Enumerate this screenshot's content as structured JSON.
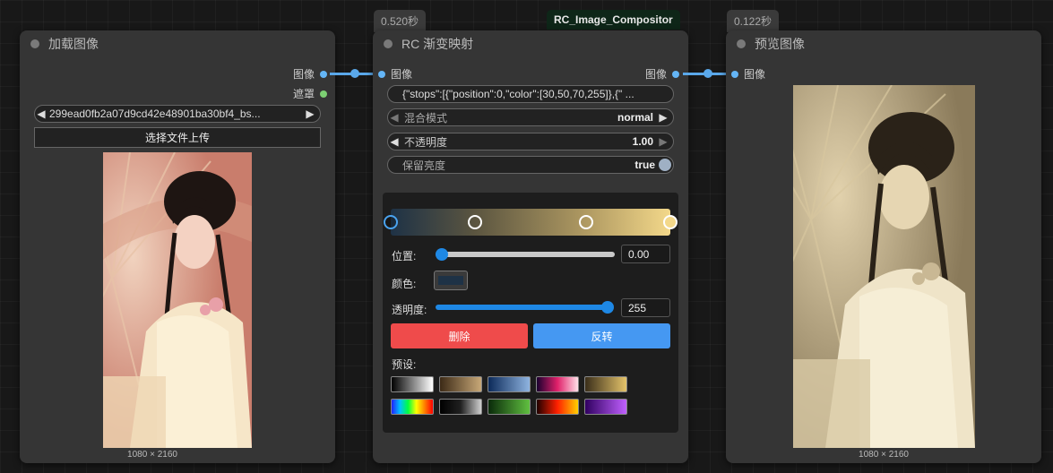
{
  "nodes": {
    "load_image": {
      "title": "加载图像",
      "outputs": [
        "图像",
        "遮罩"
      ],
      "file_name": "299ead0fb2a07d9cd42e48901ba30bf4_bs...",
      "upload_label": "选择文件上传",
      "image_size": "1080 × 2160"
    },
    "gradient_map": {
      "badge_time": "0.520秒",
      "title": "RC 渐变映射",
      "input_label": "图像",
      "output_label": "图像",
      "stops_text": "{\"stops\":[{\"position\":0,\"color\":[30,50,70,255]},{\"  ...",
      "blend_mode": {
        "label": "混合模式",
        "value": "normal"
      },
      "opacity": {
        "label": "不透明度",
        "value": "1.00"
      },
      "preserve_luminosity": {
        "label": "保留亮度",
        "value": "true"
      },
      "editor": {
        "position_label": "位置:",
        "position_value": "0.00",
        "position_fraction": 0,
        "color_label": "颜色:",
        "color_value": "#1e3246",
        "alpha_label": "透明度:",
        "alpha_value": "255",
        "alpha_fraction": 1,
        "delete_label": "删除",
        "reverse_label": "反转",
        "presets_label": "预设:"
      },
      "stop_positions": [
        0,
        0.3,
        0.7,
        1
      ]
    },
    "compositor_badge": "RC_Image_Compositor",
    "preview": {
      "badge_time": "0.122秒",
      "title": "预览图像",
      "input_label": "图像",
      "image_size": "1080 × 2160"
    }
  },
  "colors": {
    "accent": "#5aa8ea",
    "delete_button": "#ef4b4b",
    "reverse_button": "#4598f2",
    "gradient_start": "#1e3246",
    "gradient_end": "#f3d88a"
  }
}
